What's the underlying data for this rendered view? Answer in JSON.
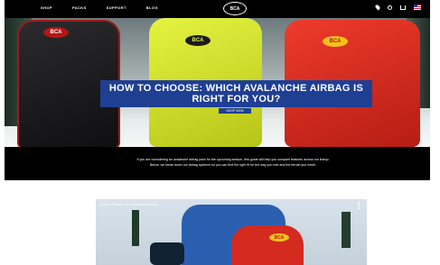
{
  "nav": {
    "links": [
      "SHOP",
      "PACKS",
      "SUPPORT",
      "BLOG"
    ],
    "logo_text": "BCA",
    "icons": [
      "location-pin-icon",
      "search-icon",
      "cart-icon",
      "us-flag-icon"
    ]
  },
  "hero": {
    "headline": "HOW TO CHOOSE: WHICH AVALANCHE AIRBAG IS RIGHT FOR YOU?",
    "cta": "SHOP NOW",
    "pack_badges": [
      "BCA",
      "BCA",
      "BCA"
    ],
    "colors": {
      "headline_bg": "#1f3f93",
      "band_bg": "#000000"
    }
  },
  "band": {
    "line1": "If you are considering an avalanche airbag pack for the upcoming season, this guide will help you compare features across our lineup.",
    "line2": "Below, we break down our airbag systems so you can find the right fit for the way you ride and the terrain you travel."
  },
  "video": {
    "title": "How to Choose an Avalanche Airbag",
    "badge": "BCA"
  }
}
